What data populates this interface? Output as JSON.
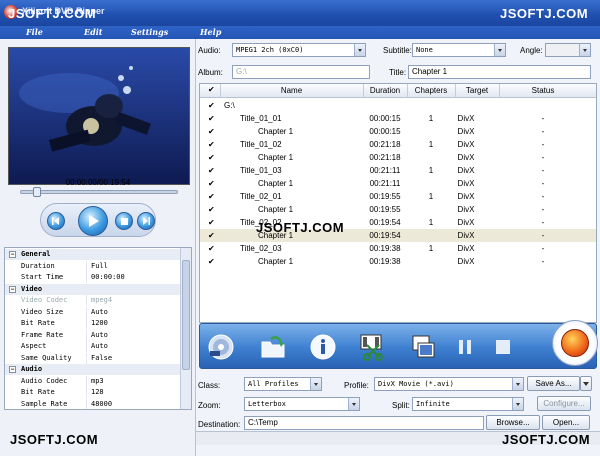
{
  "window": {
    "title": "Xilisoft DVD Ripper"
  },
  "watermarks": {
    "top_left": "JSOFTJ.COM",
    "top_right": "JSOFTJ.COM",
    "center": "JSOFTJ.COM",
    "bottom_left": "JSOFTJ.COM",
    "bottom_right": "JSOFTJ.COM"
  },
  "menu": {
    "items": [
      "File",
      "Edit",
      "Settings",
      "Help"
    ]
  },
  "player": {
    "time": "00:00:00/00:19:54",
    "seek_position": 0.08
  },
  "properties": {
    "rows": [
      {
        "type": "group",
        "label": "General"
      },
      {
        "key": "Duration",
        "value": "Full"
      },
      {
        "key": "Start Time",
        "value": "00:00:00"
      },
      {
        "type": "group",
        "label": "Video"
      },
      {
        "key": "Video Codec",
        "value": "mpeg4",
        "disabled": true
      },
      {
        "key": "Video Size",
        "value": "Auto"
      },
      {
        "key": "Bit Rate",
        "value": "1200"
      },
      {
        "key": "Frame Rate",
        "value": "Auto"
      },
      {
        "key": "Aspect",
        "value": "Auto"
      },
      {
        "key": "Same Quality",
        "value": "False"
      },
      {
        "type": "group",
        "label": "Audio"
      },
      {
        "key": "Audio Codec",
        "value": "mp3"
      },
      {
        "key": "Bit Rate",
        "value": "128"
      },
      {
        "key": "Sample Rate",
        "value": "48000"
      }
    ]
  },
  "top": {
    "audio_label": "Audio:",
    "audio_value": "MPEG1 2ch (0xC0)",
    "subtitle_label": "Subtitle:",
    "subtitle_value": "None",
    "angle_label": "Angle:",
    "angle_value": "",
    "album_label": "Album:",
    "album_value": "G:\\",
    "title_label": "Title:",
    "title_value": "Chapter 1"
  },
  "table": {
    "columns": {
      "name": "Name",
      "duration": "Duration",
      "chapters": "Chapters",
      "target": "Target",
      "status": "Status"
    },
    "root": "G:\\",
    "rows": [
      {
        "name": "Title_01_01",
        "indent": 1,
        "duration": "00:00:15",
        "chapters": "1",
        "target": "DivX",
        "status": "-"
      },
      {
        "name": "Chapter 1",
        "indent": 2,
        "duration": "00:00:15",
        "chapters": "",
        "target": "DivX",
        "status": "-"
      },
      {
        "name": "Title_01_02",
        "indent": 1,
        "duration": "00:21:18",
        "chapters": "1",
        "target": "DivX",
        "status": "-"
      },
      {
        "name": "Chapter 1",
        "indent": 2,
        "duration": "00:21:18",
        "chapters": "",
        "target": "DivX",
        "status": "-"
      },
      {
        "name": "Title_01_03",
        "indent": 1,
        "duration": "00:21:11",
        "chapters": "1",
        "target": "DivX",
        "status": "-"
      },
      {
        "name": "Chapter 1",
        "indent": 2,
        "duration": "00:21:11",
        "chapters": "",
        "target": "DivX",
        "status": "-"
      },
      {
        "name": "Title_02_01",
        "indent": 1,
        "duration": "00:19:55",
        "chapters": "1",
        "target": "DivX",
        "status": "-"
      },
      {
        "name": "Chapter 1",
        "indent": 2,
        "duration": "00:19:55",
        "chapters": "",
        "target": "DivX",
        "status": "-"
      },
      {
        "name": "Title_02_02",
        "indent": 1,
        "duration": "00:19:54",
        "chapters": "1",
        "target": "DivX",
        "status": "-"
      },
      {
        "name": "Chapter 1",
        "indent": 2,
        "duration": "00:19:54",
        "chapters": "",
        "target": "DivX",
        "status": "-",
        "selected": true
      },
      {
        "name": "Title_02_03",
        "indent": 1,
        "duration": "00:19:38",
        "chapters": "1",
        "target": "DivX",
        "status": "-"
      },
      {
        "name": "Chapter 1",
        "indent": 2,
        "duration": "00:19:38",
        "chapters": "",
        "target": "DivX",
        "status": "-"
      }
    ]
  },
  "bottom": {
    "class_label": "Class:",
    "class_value": "All Profiles",
    "profile_label": "Profile:",
    "profile_value": "DivX Movie  (*.avi)",
    "save_as": "Save As...",
    "zoom_label": "Zoom:",
    "zoom_value": "Letterbox",
    "split_label": "Split:",
    "split_value": "Infinite",
    "configure": "Configure...",
    "destination_label": "Destination:",
    "destination_value": "C:\\Temp",
    "browse": "Browse...",
    "open": "Open..."
  }
}
